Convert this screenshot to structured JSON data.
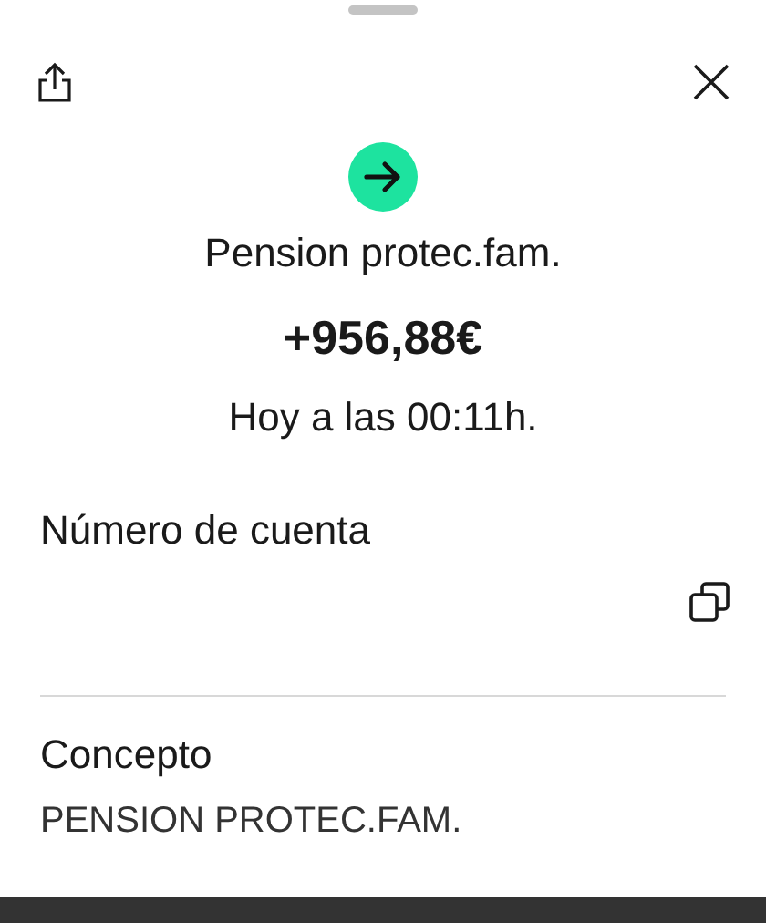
{
  "header": {
    "title": "Pension protec.fam.",
    "amount": "+956,88€",
    "date": "Hoy a las 00:11h."
  },
  "account": {
    "label": "Número de cuenta"
  },
  "concept": {
    "label": "Concepto",
    "value": "PENSION PROTEC.FAM."
  }
}
